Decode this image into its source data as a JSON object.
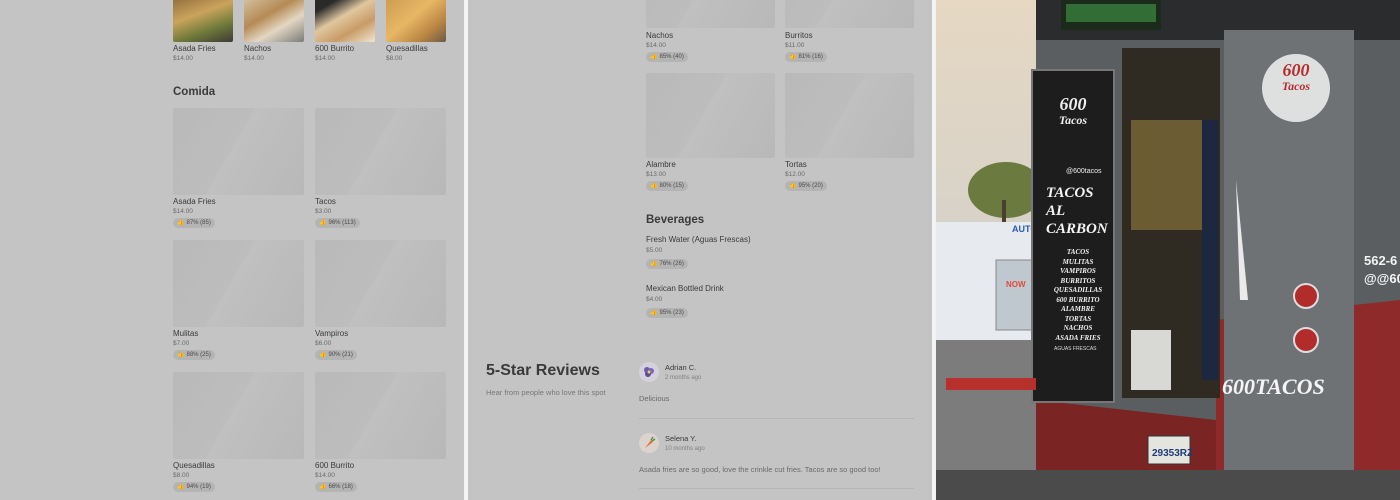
{
  "left_panel": {
    "top_items": [
      {
        "name": "Asada Fries",
        "price": "$14.00"
      },
      {
        "name": "Nachos",
        "price": "$14.00"
      },
      {
        "name": "600 Burrito",
        "price": "$14.00"
      },
      {
        "name": "Quesadillas",
        "price": "$8.00"
      }
    ],
    "section_title": "Comida",
    "comida_items": [
      {
        "name": "Asada Fries",
        "price": "$14.00",
        "rating": "87% (85)"
      },
      {
        "name": "Tacos",
        "price": "$3.00",
        "rating": "96% (113)"
      },
      {
        "name": "Mulitas",
        "price": "$7.00",
        "rating": "88% (25)"
      },
      {
        "name": "Vampiros",
        "price": "$6.00",
        "rating": "90% (21)"
      },
      {
        "name": "Quesadillas",
        "price": "$8.00",
        "rating": "94% (19)"
      },
      {
        "name": "600 Burrito",
        "price": "$14.00",
        "rating": "66% (18)"
      }
    ]
  },
  "middle_panel": {
    "items": [
      {
        "name": "Nachos",
        "price": "$14.00",
        "rating": "85% (40)"
      },
      {
        "name": "Burritos",
        "price": "$11.00",
        "rating": "81% (16)"
      },
      {
        "name": "Alambre",
        "price": "$13.00",
        "rating": "80% (15)"
      },
      {
        "name": "Tortas",
        "price": "$12.00",
        "rating": "95% (20)"
      }
    ],
    "beverages_title": "Beverages",
    "beverages": [
      {
        "name": "Fresh Water (Aguas Frescas)",
        "price": "$5.00",
        "rating": "76% (26)"
      },
      {
        "name": "Mexican Bottled Drink",
        "price": "$4.00",
        "rating": "95% (23)"
      }
    ],
    "reviews": {
      "title": "5-Star Reviews",
      "subtitle": "Hear from people who love this spot",
      "items": [
        {
          "name": "Adrian C.",
          "time": "2 months ago",
          "text": "Delicious"
        },
        {
          "name": "Selena Y.",
          "time": "10 months ago",
          "text": "Asada fries are so good, love the crinkle cut fries. Tacos are so good too!"
        }
      ]
    }
  },
  "right_panel": {
    "logo": {
      "number": "600",
      "word": "Tacos"
    },
    "menu_board": [
      "TACOS",
      "MULITAS",
      "VAMPIROS",
      "BURRITOS",
      "QUESADILLAS",
      "600 BURRITO",
      "ALAMBRE",
      "TORTAS",
      "NACHOS",
      "ASADA FRIES"
    ],
    "headline_line1": "TACOS",
    "headline_line2": "AL CARBON",
    "handle": "@600tacos",
    "side_text": "600TACOS",
    "plate": "29353RZ",
    "phone_partial": "562-6",
    "handle_partial": "@@60",
    "store_sign": "AUTO",
    "neon": "NOW",
    "aguas": "AGUAS FRESCAS"
  },
  "colors": {
    "overlay_gray": "#c4c4c4",
    "truck_red": "#9b2a2a",
    "truck_black": "#1f1f1f",
    "sky": "#d9d2c4"
  },
  "icons": {
    "thumb": "thumbs-up-icon",
    "avatar_1": "flower-avatar-icon",
    "avatar_2": "carrot-avatar-icon"
  }
}
